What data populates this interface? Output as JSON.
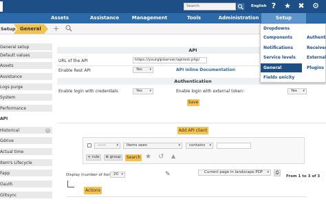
{
  "header": {
    "search_placeholder": "Search",
    "language": "English",
    "icons": [
      "help-icon",
      "star-icon",
      "tools-icon",
      "gear-icon"
    ]
  },
  "menu": {
    "items": [
      "Assets",
      "Assistance",
      "Management",
      "Tools",
      "Administration",
      "Setup"
    ]
  },
  "breadcrumb": {
    "parent": "Setup",
    "current": "General"
  },
  "sidebar": {
    "items": [
      {
        "label": "General setup"
      },
      {
        "label": "Default values"
      },
      {
        "label": "Assets"
      },
      {
        "label": "Assistance"
      },
      {
        "label": "Logs purge"
      },
      {
        "label": "System"
      },
      {
        "label": "Performance"
      },
      {
        "label": "API"
      },
      {
        "label": "Historical",
        "badge": "6"
      },
      {
        "label": "Gdrive"
      },
      {
        "label": "Actual time"
      },
      {
        "label": "Item's Lifecycle"
      },
      {
        "label": "Fapp"
      },
      {
        "label": "Oauth"
      },
      {
        "label": "Glitsync"
      }
    ]
  },
  "api": {
    "section_title": "API",
    "url_label": "URL of the API",
    "url_value": "https://yourglpiserver/apirest.php/",
    "rest_label": "Enable Rest API",
    "rest_value": "Yes",
    "inline_doc_link": "API inline Documentation",
    "auth_title": "Authentication",
    "credentials_label": "Enable login with credentials",
    "credentials_value": "Yes",
    "token_label": "Enable login with external token",
    "token_value": "Yes",
    "save_label": "Save",
    "add_client_label": "Add API client"
  },
  "search_criteria": {
    "field_value": "------",
    "items_value": "Items seen",
    "operator_value": "contains",
    "text_value": "",
    "rule_label": "rule",
    "group_label": "group",
    "search_label": "Search"
  },
  "pager": {
    "display_label": "Display (number of items)",
    "per_page": "20",
    "export_value": "Current page in landscape PDF",
    "range": "From 1 to 3 of 3",
    "actions_label": "Actions"
  },
  "dropdown": {
    "col1": [
      "Dropdowns",
      "Components",
      "Notifications",
      "Service levels",
      "General",
      "Fields unicity"
    ],
    "col2": [
      "Authentic",
      "Receivers",
      "External l",
      "Plugins"
    ],
    "active": "General"
  },
  "colors": {
    "header": "#1d4f86",
    "menubar": "#2c69a8",
    "accent_yellow": "#f5c24f"
  }
}
